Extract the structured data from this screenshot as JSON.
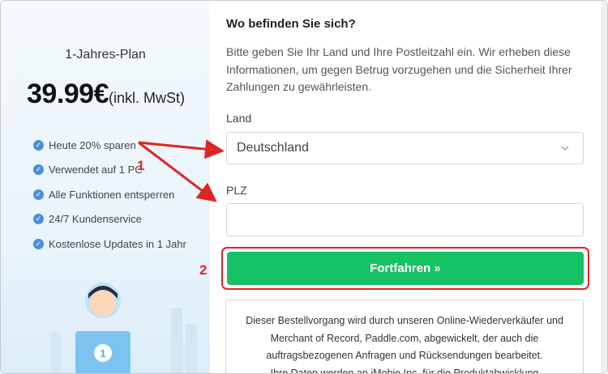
{
  "plan": {
    "title": "1-Jahres-Plan",
    "price": "39.99€",
    "price_note": "(inkl. MwSt)",
    "features": [
      "Heute 20% sparen",
      "Verwendet auf 1 PC",
      "Alle Funktionen entsperren",
      "24/7 Kundenservice",
      "Kostenlose Updates in 1 Jahr"
    ],
    "illustration_badge": "1"
  },
  "form": {
    "heading": "Wo befinden Sie sich?",
    "description": "Bitte geben Sie Ihr Land und Ihre Postleitzahl ein. Wir erheben diese Informationen, um gegen Betrug vorzugehen und die Sicherheit Ihrer Zahlungen zu gewährleisten.",
    "country_label": "Land",
    "country_value": "Deutschland",
    "zip_label": "PLZ",
    "zip_value": "",
    "submit_label": "Fortfahren »",
    "notice_line1": "Dieser Bestellvorgang wird durch unseren Online-Wiederverkäufer und Merchant of Record, Paddle.com, abgewickelt, der auch die auftragsbezogenen Anfragen und Rücksendungen bearbeitet.",
    "notice_line2": "Ihre Daten werden an iMobie Inc. für die Produktabwicklung"
  },
  "annotations": {
    "step1": "1",
    "step2": "2",
    "color": "#e02424"
  },
  "colors": {
    "accent_green": "#15c264",
    "check_blue": "#4a90d9"
  },
  "icons": [
    "check-icon",
    "chevron-down-icon",
    "user-laptop-illustration"
  ]
}
